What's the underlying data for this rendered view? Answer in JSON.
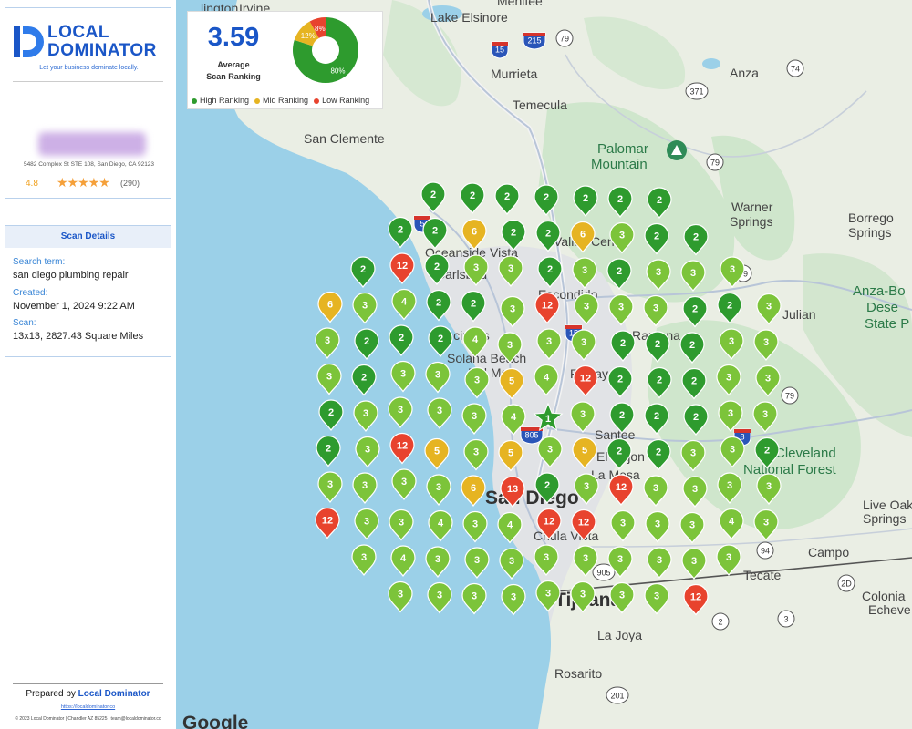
{
  "brand": {
    "name_line1": "LOCAL",
    "name_line2": "DOMINATOR",
    "tagline": "Let your business dominate locally.",
    "address": "5482 Complex St STE 108, San Diego, CA 92123",
    "rating": "4.8",
    "stars": "★★★★★",
    "review_count": "(290)"
  },
  "scan_details": {
    "title": "Scan Details",
    "search_term_label": "Search term:",
    "search_term": "san diego plumbing repair",
    "created_label": "Created:",
    "created": "November 1, 2024 9:22 AM",
    "scan_label": "Scan:",
    "scan": "13x13, 2827.43 Square Miles"
  },
  "footer": {
    "prepared_by": "Prepared by",
    "prepared_brand": "Local Dominator",
    "link": "https://localdominator.co",
    "fineprint": "© 2023 Local Dominator | Chandler AZ 85225 | team@localdominator.co"
  },
  "summary": {
    "average": "3.59",
    "average_label_1": "Average",
    "average_label_2": "Scan Ranking",
    "donut": [
      {
        "label": "80%",
        "value": 80,
        "color": "#2e9b2e"
      },
      {
        "label": "12%",
        "value": 12,
        "color": "#e6b422"
      },
      {
        "label": "8%",
        "value": 8,
        "color": "#e8432e"
      }
    ],
    "legend": [
      {
        "label": "High Ranking",
        "color": "#2e9b2e"
      },
      {
        "label": "Mid Ranking",
        "color": "#e6b422"
      },
      {
        "label": "Low Ranking",
        "color": "#e8432e"
      }
    ]
  },
  "map_labels": {
    "lake_elsinore": "Lake Elsinore",
    "irvine": "Irvine",
    "arlington": "lington",
    "menifee": "Menifee",
    "murrieta": "Murrieta",
    "temecula": "Temecula",
    "anza": "Anza",
    "san_clemente": "San Clemente",
    "palomar_1": "Palomar",
    "palomar_2": "Mountain",
    "warner_1": "Warner",
    "warner_2": "Springs",
    "borrego_1": "Borrego",
    "borrego_2": "Springs",
    "anza_borrego_1": "Anza-Bo",
    "anza_borrego_2": "Dese",
    "anza_borrego_3": "State P",
    "julian": "Julian",
    "oceanside": "Oceanside",
    "vista": "Vista",
    "carlsbad": "Carlsbad",
    "valley_center": "Valley Cen",
    "escondido": "Escondido",
    "encinitas": "Encinitas",
    "solana_beach": "Solana Beach",
    "del_mar": "Del Mar",
    "ramona": "Ramona",
    "poway": "Poway",
    "santee": "Santee",
    "el_cajon": "El Cajon",
    "la_mesa": "La Mesa",
    "cleveland_1": "Cleveland",
    "cleveland_2": "National Forest",
    "san_diego": "San Diego",
    "chula_vista": "Chula Vista",
    "live_oak_1": "Live Oak",
    "live_oak_2": "Springs",
    "campo": "Campo",
    "tecate": "Tecate",
    "tijuana": "Tijuana",
    "playas": "La Joya",
    "colonia_1": "Colonia",
    "colonia_2": "Echeve",
    "rosarito": "Rosarito",
    "google": "Google",
    "shields": [
      "15",
      "215",
      "79",
      "74",
      "371",
      "79",
      "5",
      "79",
      "15",
      "79",
      "805",
      "8",
      "94",
      "905",
      "2D",
      "2",
      "3",
      "201"
    ]
  },
  "grid": {
    "center_label": "1",
    "pins": [
      {
        "v": 2
      },
      {
        "v": 2
      },
      {
        "v": 2
      },
      {
        "v": 2
      },
      {
        "v": 2
      },
      {
        "v": 2
      },
      {
        "v": 2
      },
      {
        "v": 2
      },
      {
        "v": 2
      },
      {
        "v": 6
      },
      {
        "v": 2
      },
      {
        "v": 2
      },
      {
        "v": 6
      },
      {
        "v": 3
      },
      {
        "v": 2
      },
      {
        "v": 2
      },
      {
        "v": 2
      },
      {
        "v": 12
      },
      {
        "v": 2
      },
      {
        "v": 3
      },
      {
        "v": 3
      },
      {
        "v": 2
      },
      {
        "v": 3
      },
      {
        "v": 2
      },
      {
        "v": 3
      },
      {
        "v": 3
      },
      {
        "v": 3
      },
      {
        "v": 6
      },
      {
        "v": 3
      },
      {
        "v": 4
      },
      {
        "v": 2
      },
      {
        "v": 2
      },
      {
        "v": 3
      },
      {
        "v": 12
      },
      {
        "v": 3
      },
      {
        "v": 3
      },
      {
        "v": 3
      },
      {
        "v": 2
      },
      {
        "v": 2
      },
      {
        "v": 3
      },
      {
        "v": 3
      },
      {
        "v": 2
      },
      {
        "v": 2
      },
      {
        "v": 2
      },
      {
        "v": 4
      },
      {
        "v": 3
      },
      {
        "v": 3
      },
      {
        "v": 3
      },
      {
        "v": 2
      },
      {
        "v": 2
      },
      {
        "v": 2
      },
      {
        "v": 3
      },
      {
        "v": 3
      },
      {
        "v": 3
      },
      {
        "v": 2
      },
      {
        "v": 3
      },
      {
        "v": 3
      },
      {
        "v": 3
      },
      {
        "v": 5
      },
      {
        "v": 4
      },
      {
        "v": 12
      },
      {
        "v": 2
      },
      {
        "v": 2
      },
      {
        "v": 2
      },
      {
        "v": 3
      },
      {
        "v": 3
      },
      {
        "v": 2
      },
      {
        "v": 3
      },
      {
        "v": 3
      },
      {
        "v": 3
      },
      {
        "v": 3
      },
      {
        "v": 4
      },
      {
        "v": 3
      },
      {
        "v": 2
      },
      {
        "v": 2
      },
      {
        "v": 2
      },
      {
        "v": 3
      },
      {
        "v": 3
      },
      {
        "v": 2
      },
      {
        "v": 3
      },
      {
        "v": 12
      },
      {
        "v": 5
      },
      {
        "v": 3
      },
      {
        "v": 5
      },
      {
        "v": 3
      },
      {
        "v": 5
      },
      {
        "v": 2
      },
      {
        "v": 2
      },
      {
        "v": 3
      },
      {
        "v": 3
      },
      {
        "v": 2
      },
      {
        "v": 3
      },
      {
        "v": 3
      },
      {
        "v": 3
      },
      {
        "v": 3
      },
      {
        "v": 6
      },
      {
        "v": 13
      },
      {
        "v": 2
      },
      {
        "v": 3
      },
      {
        "v": 12
      },
      {
        "v": 3
      },
      {
        "v": 3
      },
      {
        "v": 3
      },
      {
        "v": 3
      },
      {
        "v": 12
      },
      {
        "v": 3
      },
      {
        "v": 3
      },
      {
        "v": 4
      },
      {
        "v": 3
      },
      {
        "v": 4
      },
      {
        "v": 12
      },
      {
        "v": 12
      },
      {
        "v": 3
      },
      {
        "v": 3
      },
      {
        "v": 3
      },
      {
        "v": 4
      },
      {
        "v": 3
      },
      {
        "v": 3
      },
      {
        "v": 4
      },
      {
        "v": 3
      },
      {
        "v": 3
      },
      {
        "v": 3
      },
      {
        "v": 3
      },
      {
        "v": 3
      },
      {
        "v": 3
      },
      {
        "v": 3
      },
      {
        "v": 3
      },
      {
        "v": 3
      },
      {
        "v": 3
      },
      {
        "v": 3
      },
      {
        "v": 3
      },
      {
        "v": 3
      },
      {
        "v": 3
      },
      {
        "v": 3
      },
      {
        "v": 3
      },
      {
        "v": 3
      },
      {
        "v": 12
      }
    ]
  }
}
